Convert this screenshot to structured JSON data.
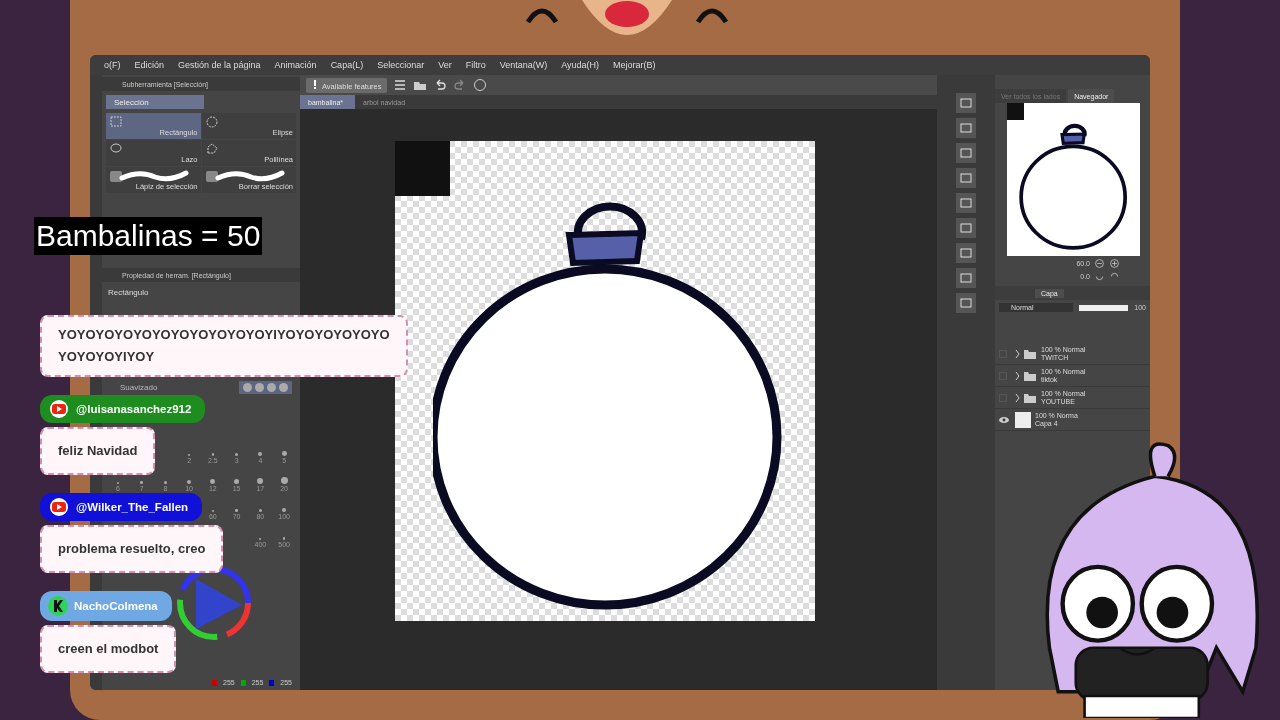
{
  "menu": [
    "o(F)",
    "Edición",
    "Gestión de la página",
    "Animación",
    "Capa(L)",
    "Seleccionar",
    "Ver",
    "Filtro",
    "Ventana(W)",
    "Ayuda(H)",
    "Mejorar(B)"
  ],
  "toolbar": {
    "notice": "Available features"
  },
  "document_tabs": [
    {
      "label": "bambalina*",
      "selected": true
    },
    {
      "label": "arbol navidad",
      "selected": false
    }
  ],
  "subtool_panel": {
    "title": "Subherramienta [Selección]",
    "group": "Selección",
    "tools": [
      {
        "label": "Rectángulo",
        "selected": true
      },
      {
        "label": "Elipse",
        "selected": false
      },
      {
        "label": "Lazo",
        "selected": false
      },
      {
        "label": "Polilínea",
        "selected": false
      },
      {
        "label": "Lápiz de selección",
        "selected": false
      },
      {
        "label": "Borrar selección",
        "selected": false
      }
    ]
  },
  "property_panel": {
    "title": "Propiedad de herram. [Rectángulo]",
    "tool": "Rectángulo",
    "smoothing": "Suavizado"
  },
  "brush_sizes": [
    {
      "labels": [
        "2",
        "2.5",
        "3",
        "4",
        "5"
      ]
    },
    {
      "labels": [
        "6",
        "7",
        "8",
        "10",
        "12",
        "15",
        "17",
        "20"
      ]
    },
    {
      "labels": [
        "60",
        "70",
        "80",
        "100"
      ]
    },
    {
      "labels": [
        "400",
        "500"
      ]
    }
  ],
  "color": {
    "r": "255",
    "g": "255",
    "b": "255"
  },
  "navigator": {
    "tabs": [
      {
        "label": "Ver todos los lados",
        "selected": false
      },
      {
        "label": "Navegador",
        "selected": true
      }
    ],
    "zoom": "60.0",
    "rotation": "0.0"
  },
  "layer_panel": {
    "tab": "Capa",
    "blend_mode": "Normal",
    "opacity": "100",
    "opacity_level": {
      "level": 1
    },
    "layers": [
      {
        "kind": "folder",
        "mode": "100 % Normal",
        "name": "TWITCH",
        "visible": false
      },
      {
        "kind": "folder",
        "mode": "100 % Normal",
        "name": "tiktok",
        "visible": false
      },
      {
        "kind": "folder",
        "mode": "100 % Normal",
        "name": "YOUTUBE",
        "visible": false
      },
      {
        "kind": "layer",
        "mode": "100 % Norma",
        "name": "Capa 4",
        "visible": true
      }
    ]
  },
  "counter": "Bambalinas = 50",
  "chat": [
    {
      "kind": "plain",
      "text": "YOYOYOYOYOYOYOYOYOYOYOYIYOYOYOYOYOYOYOYOYOYIYOY"
    },
    {
      "kind": "youtube",
      "user": "@luisanasanchez912",
      "color": "#1e8c1e",
      "text": "feliz Navidad"
    },
    {
      "kind": "youtube",
      "user": "@Wilker_The_Fallen",
      "color": "#1010d8",
      "text": "problema resuelto, creo"
    },
    {
      "kind": "kick",
      "user": "NachoColmena",
      "color": "#6fa8e2",
      "text": "creen el modbot"
    }
  ]
}
